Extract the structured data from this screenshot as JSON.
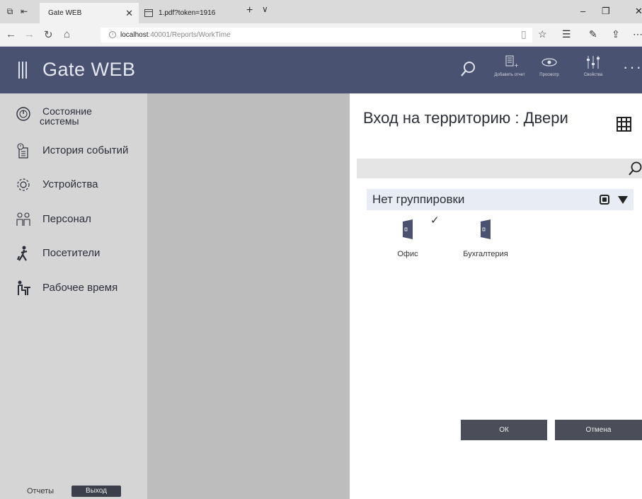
{
  "browser": {
    "tabs": [
      {
        "title": "Gate WEB",
        "active": true
      },
      {
        "title": "1.pdf?token=1916",
        "active": false
      }
    ],
    "url_host": "localhost",
    "url_path": ":40001/Reports/WorkTime"
  },
  "app": {
    "title": "Gate WEB",
    "toolbar": {
      "add_report": "Добавить отчет",
      "preview": "Просмотр",
      "properties": "Свойства"
    }
  },
  "sidebar": {
    "items": [
      {
        "label_line1": "Состояние",
        "label_line2": "системы",
        "icon": "gauge-icon"
      },
      {
        "label": "История событий",
        "icon": "history-icon"
      },
      {
        "label": "Устройства",
        "icon": "gear-icon"
      },
      {
        "label": "Персонал",
        "icon": "people-icon"
      },
      {
        "label": "Посетители",
        "icon": "walker-icon"
      },
      {
        "label": "Рабочее время",
        "icon": "worker-icon"
      }
    ],
    "footer_reports": "Отчеты",
    "footer_exit": "Выход"
  },
  "dialog": {
    "title": "Вход на территорию : Двери",
    "search_placeholder": "",
    "group_label": "Нет группировки",
    "doors": [
      {
        "label": "Офис",
        "checked": true
      },
      {
        "label": "Бухгалтерия",
        "checked": false
      }
    ],
    "ok_label": "ОК",
    "cancel_label": "Отмена"
  },
  "colors": {
    "header_bg": "#4a5271",
    "sidebar_bg": "#d5d5d5",
    "door_color": "#4a5271",
    "button_bg": "#4b4e58"
  }
}
